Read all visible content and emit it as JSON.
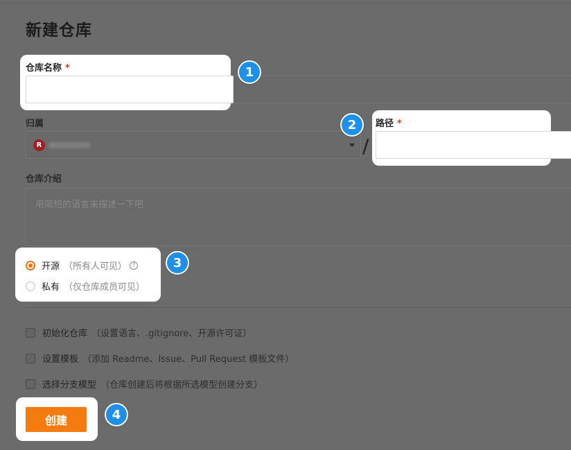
{
  "page": {
    "title": "新建仓库"
  },
  "form": {
    "repo_name": {
      "label": "仓库名称",
      "required_mark": "*",
      "value": ""
    },
    "owner": {
      "label": "归属",
      "avatar_initial": "R",
      "value": ""
    },
    "path": {
      "label": "路径",
      "required_mark": "*",
      "separator": "/",
      "value": ""
    },
    "description": {
      "label": "仓库介绍",
      "placeholder": "用简短的语言来描述一下吧"
    },
    "visibility": {
      "options": [
        {
          "label": "开源",
          "hint": "（所有人可见）",
          "selected": true,
          "help": "?"
        },
        {
          "label": "私有",
          "hint": "（仅仓库成员可见）",
          "selected": false
        }
      ]
    },
    "checkboxes": [
      {
        "label": "初始化仓库",
        "hint": "（设置语言、.gitignore、开源许可证）",
        "checked": false
      },
      {
        "label": "设置模板",
        "hint": "（添加 Readme、Issue、Pull Request 模板文件）",
        "checked": false
      },
      {
        "label": "选择分支模型",
        "hint": "（仓库创建后将根据所选模型创建分支）",
        "checked": false
      }
    ],
    "submit_label": "创建"
  },
  "annotations": [
    "1",
    "2",
    "3",
    "4"
  ],
  "colors": {
    "accent": "#f37b0f",
    "badge": "#1e90e8",
    "required": "#e0361f"
  }
}
